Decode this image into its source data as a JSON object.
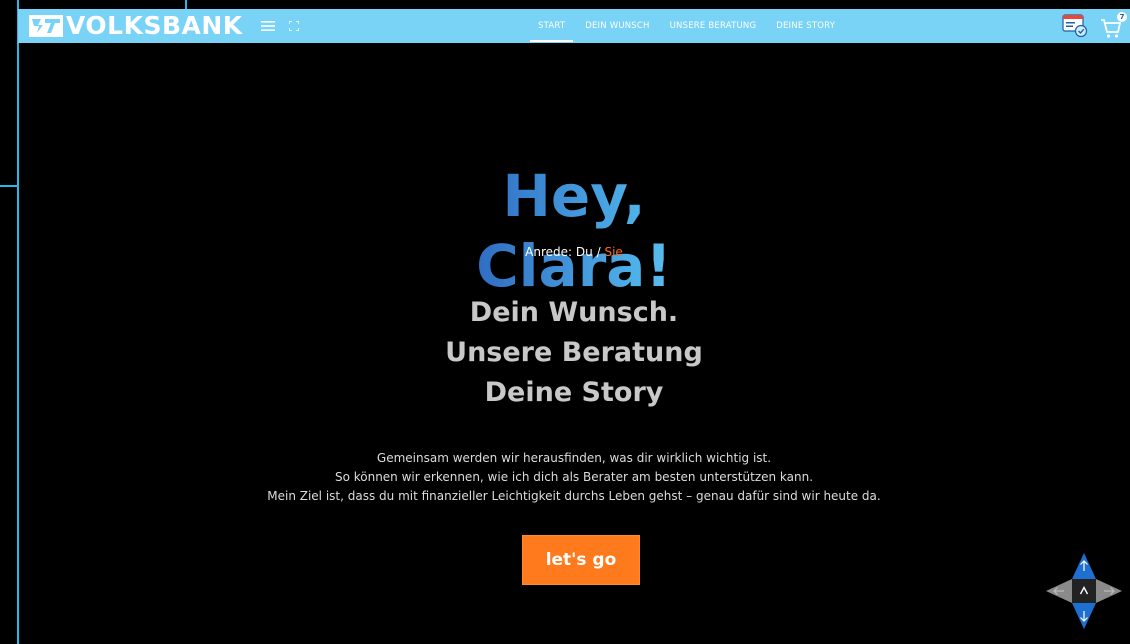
{
  "brand": {
    "name": "VOLKSBANK",
    "logo_icon": "volksbank-logo-icon"
  },
  "toolbar": {
    "menu_icon": "hamburger-menu-icon",
    "fullscreen_icon": "fullscreen-icon"
  },
  "nav": {
    "items": [
      {
        "label": "START",
        "active": true
      },
      {
        "label": "DEIN WUNSCH",
        "active": false
      },
      {
        "label": "UNSERE BERATUNG",
        "active": false
      },
      {
        "label": "DEINE STORY",
        "active": false
      }
    ]
  },
  "header_right": {
    "advisor_icon": "advisor-checklist-icon",
    "cart_icon": "shopping-cart-icon",
    "cart_count": "7"
  },
  "hero": {
    "greeting": "Hey, Clara!",
    "salutation_label": "Anrede:",
    "salutation_du": "Du",
    "salutation_separator": "/",
    "salutation_sie": "Sie",
    "headline_lines": [
      "Dein Wunsch.",
      "Unsere Beratung",
      "Deine Story"
    ],
    "intro_lines": [
      "Gemeinsam werden wir herausfinden, was dir wirklich wichtig ist.",
      "So können wir erkennen, wie ich dich als Berater am besten unterstützen kann.",
      "Mein Ziel ist, dass du mit finanzieller Leichtigkeit durchs Leben gehst – genau dafür sind wir heute da."
    ],
    "cta_label": "let's go"
  },
  "colors": {
    "topbar": "#78d3f7",
    "accent_orange": "#ff7a1c",
    "frame": "#29b6ea",
    "blue": "#1f6fd1"
  }
}
